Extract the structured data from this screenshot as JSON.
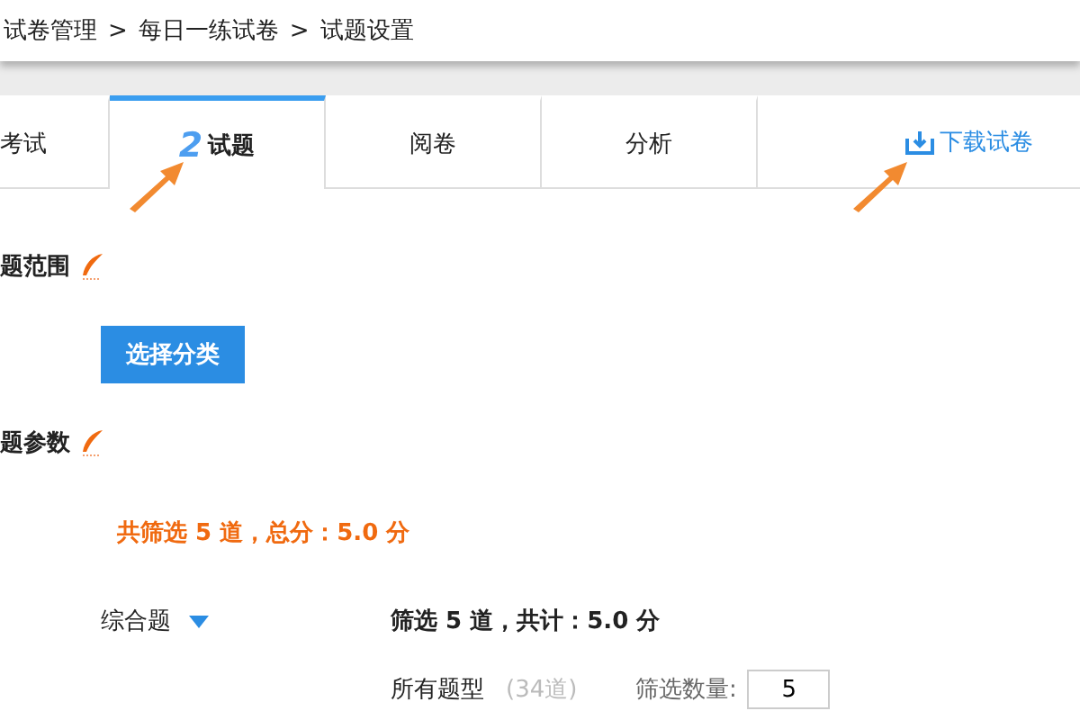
{
  "breadcrumb": [
    "试卷管理",
    "每日一练试卷",
    "试题设置"
  ],
  "breadcrumb_separator": ">",
  "tabs": [
    {
      "label": "考试",
      "selected": false
    },
    {
      "label": "试题",
      "step": "2",
      "selected": true
    },
    {
      "label": "阅卷",
      "selected": false
    },
    {
      "label": "分析",
      "selected": false
    }
  ],
  "download_link": "下载试卷",
  "sections": [
    {
      "title": "题范围"
    },
    {
      "title": "题参数"
    }
  ],
  "choose_category_button": "选择分类",
  "summary": "共筛选 5 道，总分：5.0 分",
  "question_type": {
    "label": "综合题",
    "expanded": true,
    "subtotal": "筛选 5 道，共计：5.0 分"
  },
  "filter_row": {
    "type_label": "所有题型",
    "count": "(34道)",
    "quantity_label": "筛选数量:",
    "quantity": "5"
  }
}
